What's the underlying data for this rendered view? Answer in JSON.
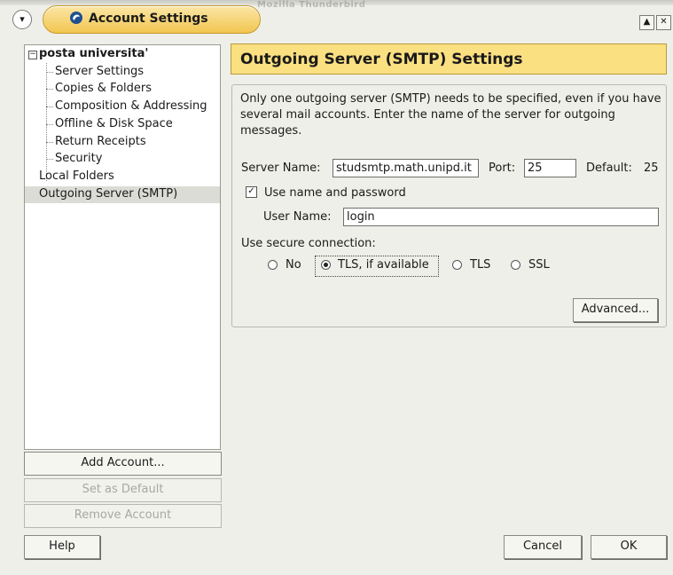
{
  "window": {
    "title": "Account Settings",
    "background_title": "Mozilla Thunderbird"
  },
  "sidebar": {
    "tree": [
      {
        "label": "posta universita'",
        "level": 0,
        "expanded": true
      },
      {
        "label": "Server Settings",
        "level": 1
      },
      {
        "label": "Copies & Folders",
        "level": 1
      },
      {
        "label": "Composition & Addressing",
        "level": 1
      },
      {
        "label": "Offline & Disk Space",
        "level": 1
      },
      {
        "label": "Return Receipts",
        "level": 1
      },
      {
        "label": "Security",
        "level": 1
      },
      {
        "label": "Local Folders",
        "level": 0
      },
      {
        "label": "Outgoing Server (SMTP)",
        "level": 0,
        "selected": true
      }
    ],
    "buttons": {
      "add_account": "Add Account...",
      "set_default": "Set as Default",
      "remove_account": "Remove Account"
    }
  },
  "panel": {
    "header": "Outgoing Server (SMTP) Settings",
    "description": "Only one outgoing server (SMTP) needs to be specified, even if you have several mail accounts. Enter the name of the server for outgoing messages.",
    "server_name_label": "Server Name:",
    "server_name_value": "studsmtp.math.unipd.it",
    "port_label": "Port:",
    "port_value": "25",
    "default_label": "Default:",
    "default_value": "25",
    "use_name_password_label": "Use name and password",
    "use_name_password_checked": true,
    "user_name_label": "User Name:",
    "user_name_value": "login",
    "secure_label": "Use secure connection:",
    "secure_options": [
      {
        "label": "No",
        "selected": false
      },
      {
        "label": "TLS, if available",
        "selected": true
      },
      {
        "label": "TLS",
        "selected": false
      },
      {
        "label": "SSL",
        "selected": false
      }
    ],
    "advanced_button": "Advanced..."
  },
  "footer": {
    "help": "Help",
    "cancel": "Cancel",
    "ok": "OK"
  },
  "colors": {
    "header_fill": "#fbe081",
    "title_pill": "#f2c650",
    "dialog_bg": "#efefe9"
  }
}
